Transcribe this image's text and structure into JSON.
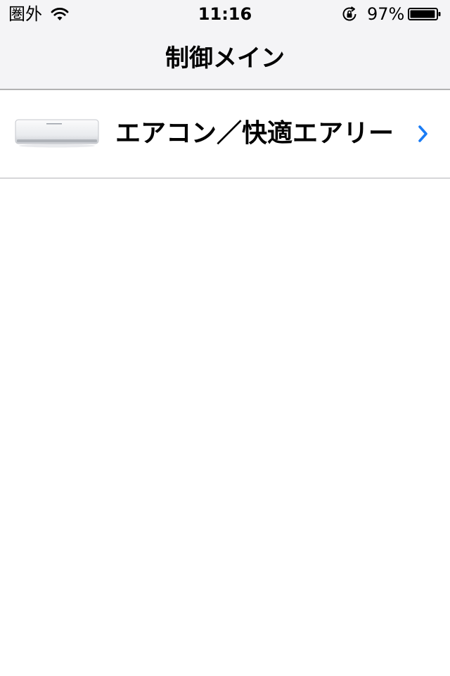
{
  "status_bar": {
    "carrier": "圏外",
    "time": "11:16",
    "battery_percent": "97%",
    "battery_level": 0.97,
    "icons": [
      "wifi-icon",
      "rotation-lock-icon",
      "battery-icon"
    ]
  },
  "nav": {
    "title": "制御メイン"
  },
  "list": {
    "items": [
      {
        "label": "エアコン／快適エアリー",
        "thumbnail": "air-conditioner-image",
        "accessory": "chevron-right-icon"
      }
    ]
  },
  "colors": {
    "bar_background": "#f4f4f6",
    "chevron_accent": "#1a7cf5",
    "separator": "#d6d6d8"
  }
}
